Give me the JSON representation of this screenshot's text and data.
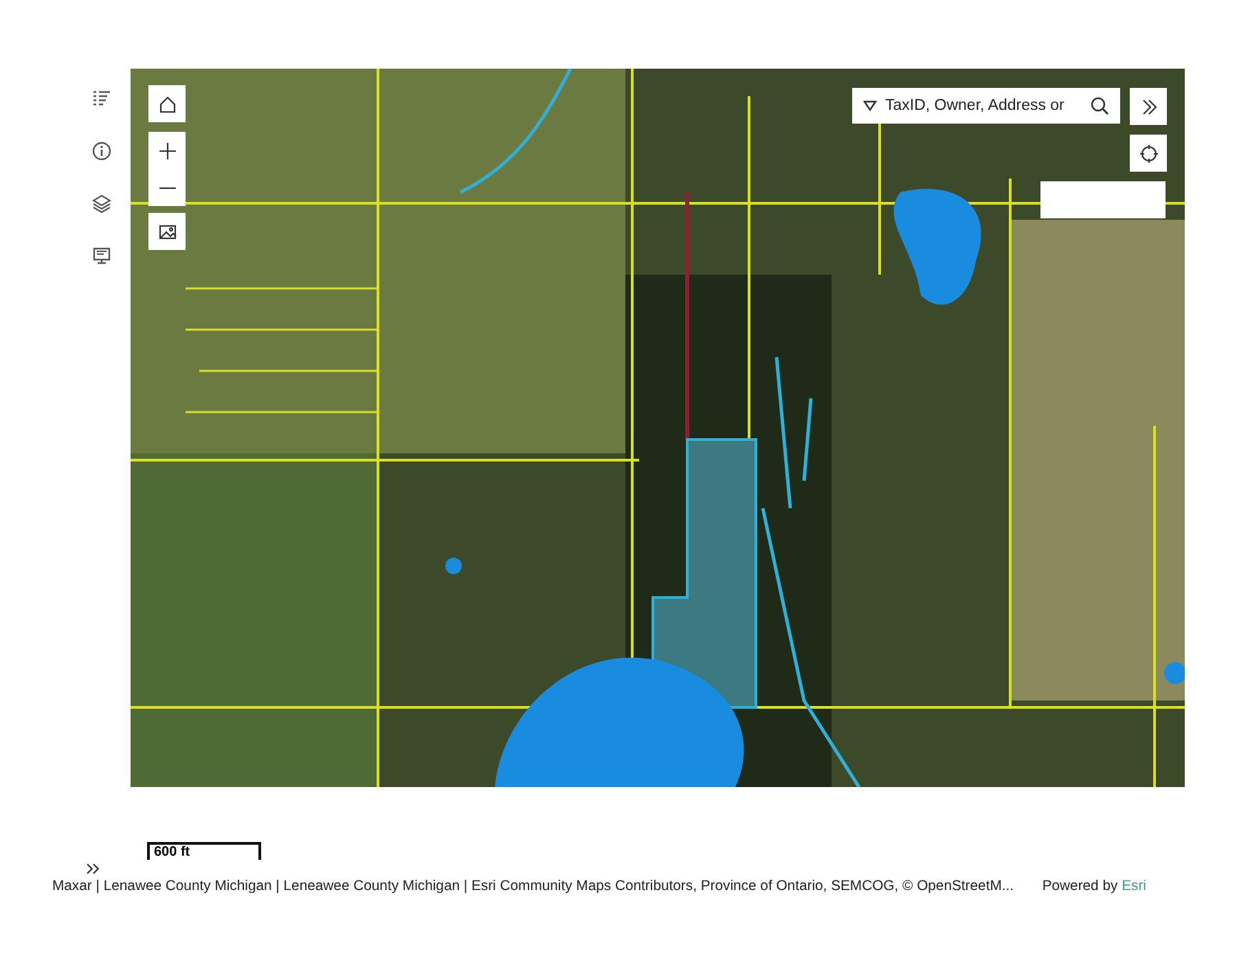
{
  "search": {
    "placeholder": "TaxID, Owner, Address or"
  },
  "scale_bar": {
    "label": "600 ft"
  },
  "attribution": {
    "text": "Maxar | Lenawee County Michigan | Leneawee County Michigan | Esri Community Maps Contributors, Province of Ontario, SEMCOG, © OpenStreetM...",
    "powered_by": "Powered by",
    "brand": "Esri"
  }
}
